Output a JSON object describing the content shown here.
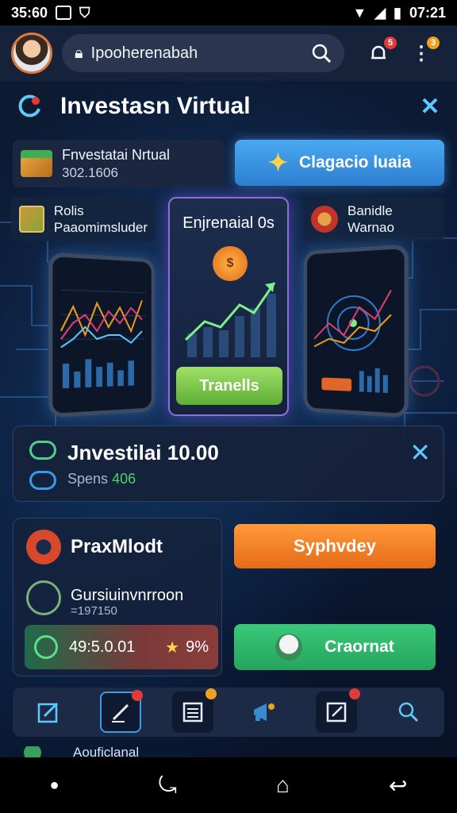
{
  "status": {
    "time_left": "35:60",
    "time_right": "07:21"
  },
  "topbar": {
    "url": "Ipooherenabah",
    "notif_badge": "5",
    "menu_badge": "3"
  },
  "header": {
    "title": "Investasn Virtual"
  },
  "balance": {
    "label": "Fnvestatai Nrtual",
    "value": "302.1606"
  },
  "primary_button": "Clagacio luaia",
  "features": {
    "left_l1": "Rolis",
    "left_l2": "Paaomimsluder",
    "center_title": "Enjrenaial 0s",
    "center_coin": "$",
    "center_button": "Tranells",
    "right_l1": "Banidle",
    "right_l2": "Warnao"
  },
  "notification": {
    "title": "Jnvestilai 10.00",
    "sub_label": "Spens",
    "sub_value": "406"
  },
  "panel": {
    "title": "PraxMlodt",
    "conversion": "Gursiuinvnrroon",
    "conversion_sub": "=197150",
    "stat_value": "49:5.0.01",
    "stat_pct": "9%",
    "orange_button": "Syphvdey",
    "green_button": "Craornat"
  },
  "partial_row": {
    "label": "Aouficlanal"
  },
  "colors": {
    "accent_blue": "#3a9be8",
    "orange": "#e56a18",
    "green": "#24a55e",
    "purple_border": "#8f6cd8"
  }
}
